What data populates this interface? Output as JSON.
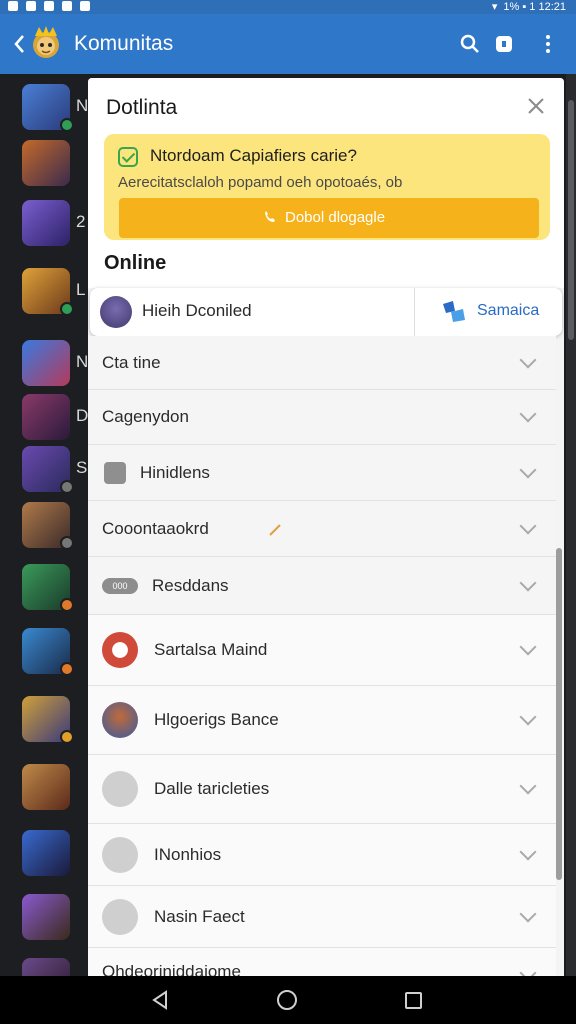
{
  "status_bar": {
    "right_text": "1% ▪ 1 ⁣12:21"
  },
  "app_bar": {
    "title": "Komunitas"
  },
  "left_list": {
    "letters": [
      "N",
      "2",
      "L",
      "N",
      "D",
      "S"
    ]
  },
  "panel": {
    "title": "Dotlinta",
    "promo": {
      "title": "Ntordoam Capiafiers carie?",
      "subtitle": "Aerecitatsclaloh popamd oeh opotoaés, ob",
      "button_label": "Dobol dlogagle"
    },
    "section_label": "Online",
    "online_user": {
      "name": "Hieih Dconiled",
      "action_label": "Samaica"
    },
    "rows": [
      {
        "label": "Cta tine"
      },
      {
        "label": "Cagenydon"
      },
      {
        "label": "Hinidlens"
      },
      {
        "label": "Cooontaaokrd"
      },
      {
        "label": "Resddans",
        "pill": "000"
      },
      {
        "label": "Sartalsa Maind"
      },
      {
        "label": "Hlgoerigs Bance"
      },
      {
        "label": "Dalle taricleties"
      },
      {
        "label": "INonhios"
      },
      {
        "label": "Nasin Faect"
      },
      {
        "label": "Ohdeoriniddaiome"
      }
    ]
  },
  "colors": {
    "app_bar": "#2f78c9",
    "promo_bg": "#fce57c",
    "promo_button": "#f6b21a",
    "action_blue": "#2a6bc7"
  }
}
